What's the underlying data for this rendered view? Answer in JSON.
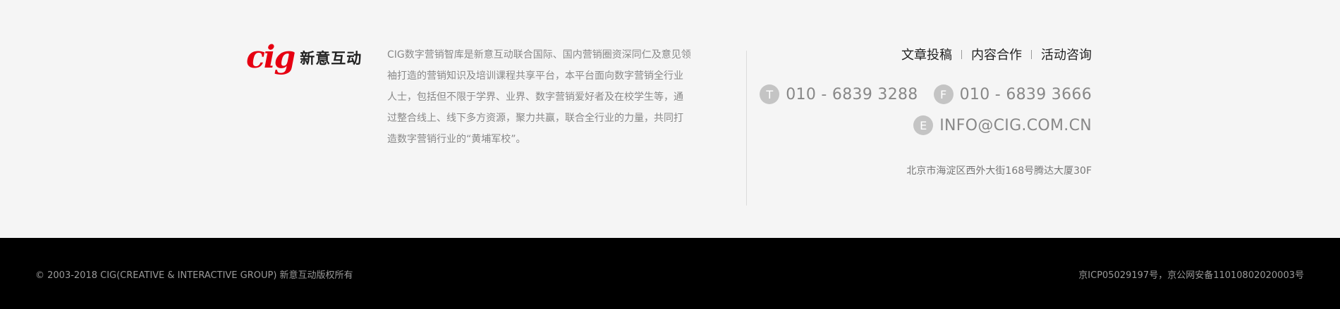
{
  "logo": {
    "mark": "cig",
    "text": "新意互动"
  },
  "intro": "CIG数字营销智库是新意互动联合国际、国内营销圈资深同仁及意见领袖打造的营销知识及培训课程共享平台，本平台面向数字营销全行业人士，包括但不限于学界、业界、数字营销爱好者及在校学生等，通过整合线上、线下多方资源，聚力共赢，联合全行业的力量，共同打造数字营销行业的“黄埔军校”。",
  "nav": [
    {
      "label": "文章投稿"
    },
    {
      "label": "内容合作"
    },
    {
      "label": "活动咨询"
    }
  ],
  "contact": {
    "phone": {
      "badge": "T",
      "value": "010 - 6839 3288"
    },
    "fax": {
      "badge": "F",
      "value": "010 - 6839 3666"
    },
    "email": {
      "badge": "E",
      "value": "INFO@CIG.COM.CN"
    }
  },
  "address": "北京市海淀区西外大街168号腾达大厦30F",
  "bottom": {
    "copyright": "© 2003-2018 CIG(CREATIVE & INTERACTIVE GROUP) 新意互动版权所有",
    "icp": "京ICP05029197号，京公网安备11010802020003号"
  },
  "colors": {
    "brand_red": "#e60012",
    "background": "#f5f5f5",
    "bottom_bar": "#000000",
    "badge_gray": "#c4c4c4"
  }
}
